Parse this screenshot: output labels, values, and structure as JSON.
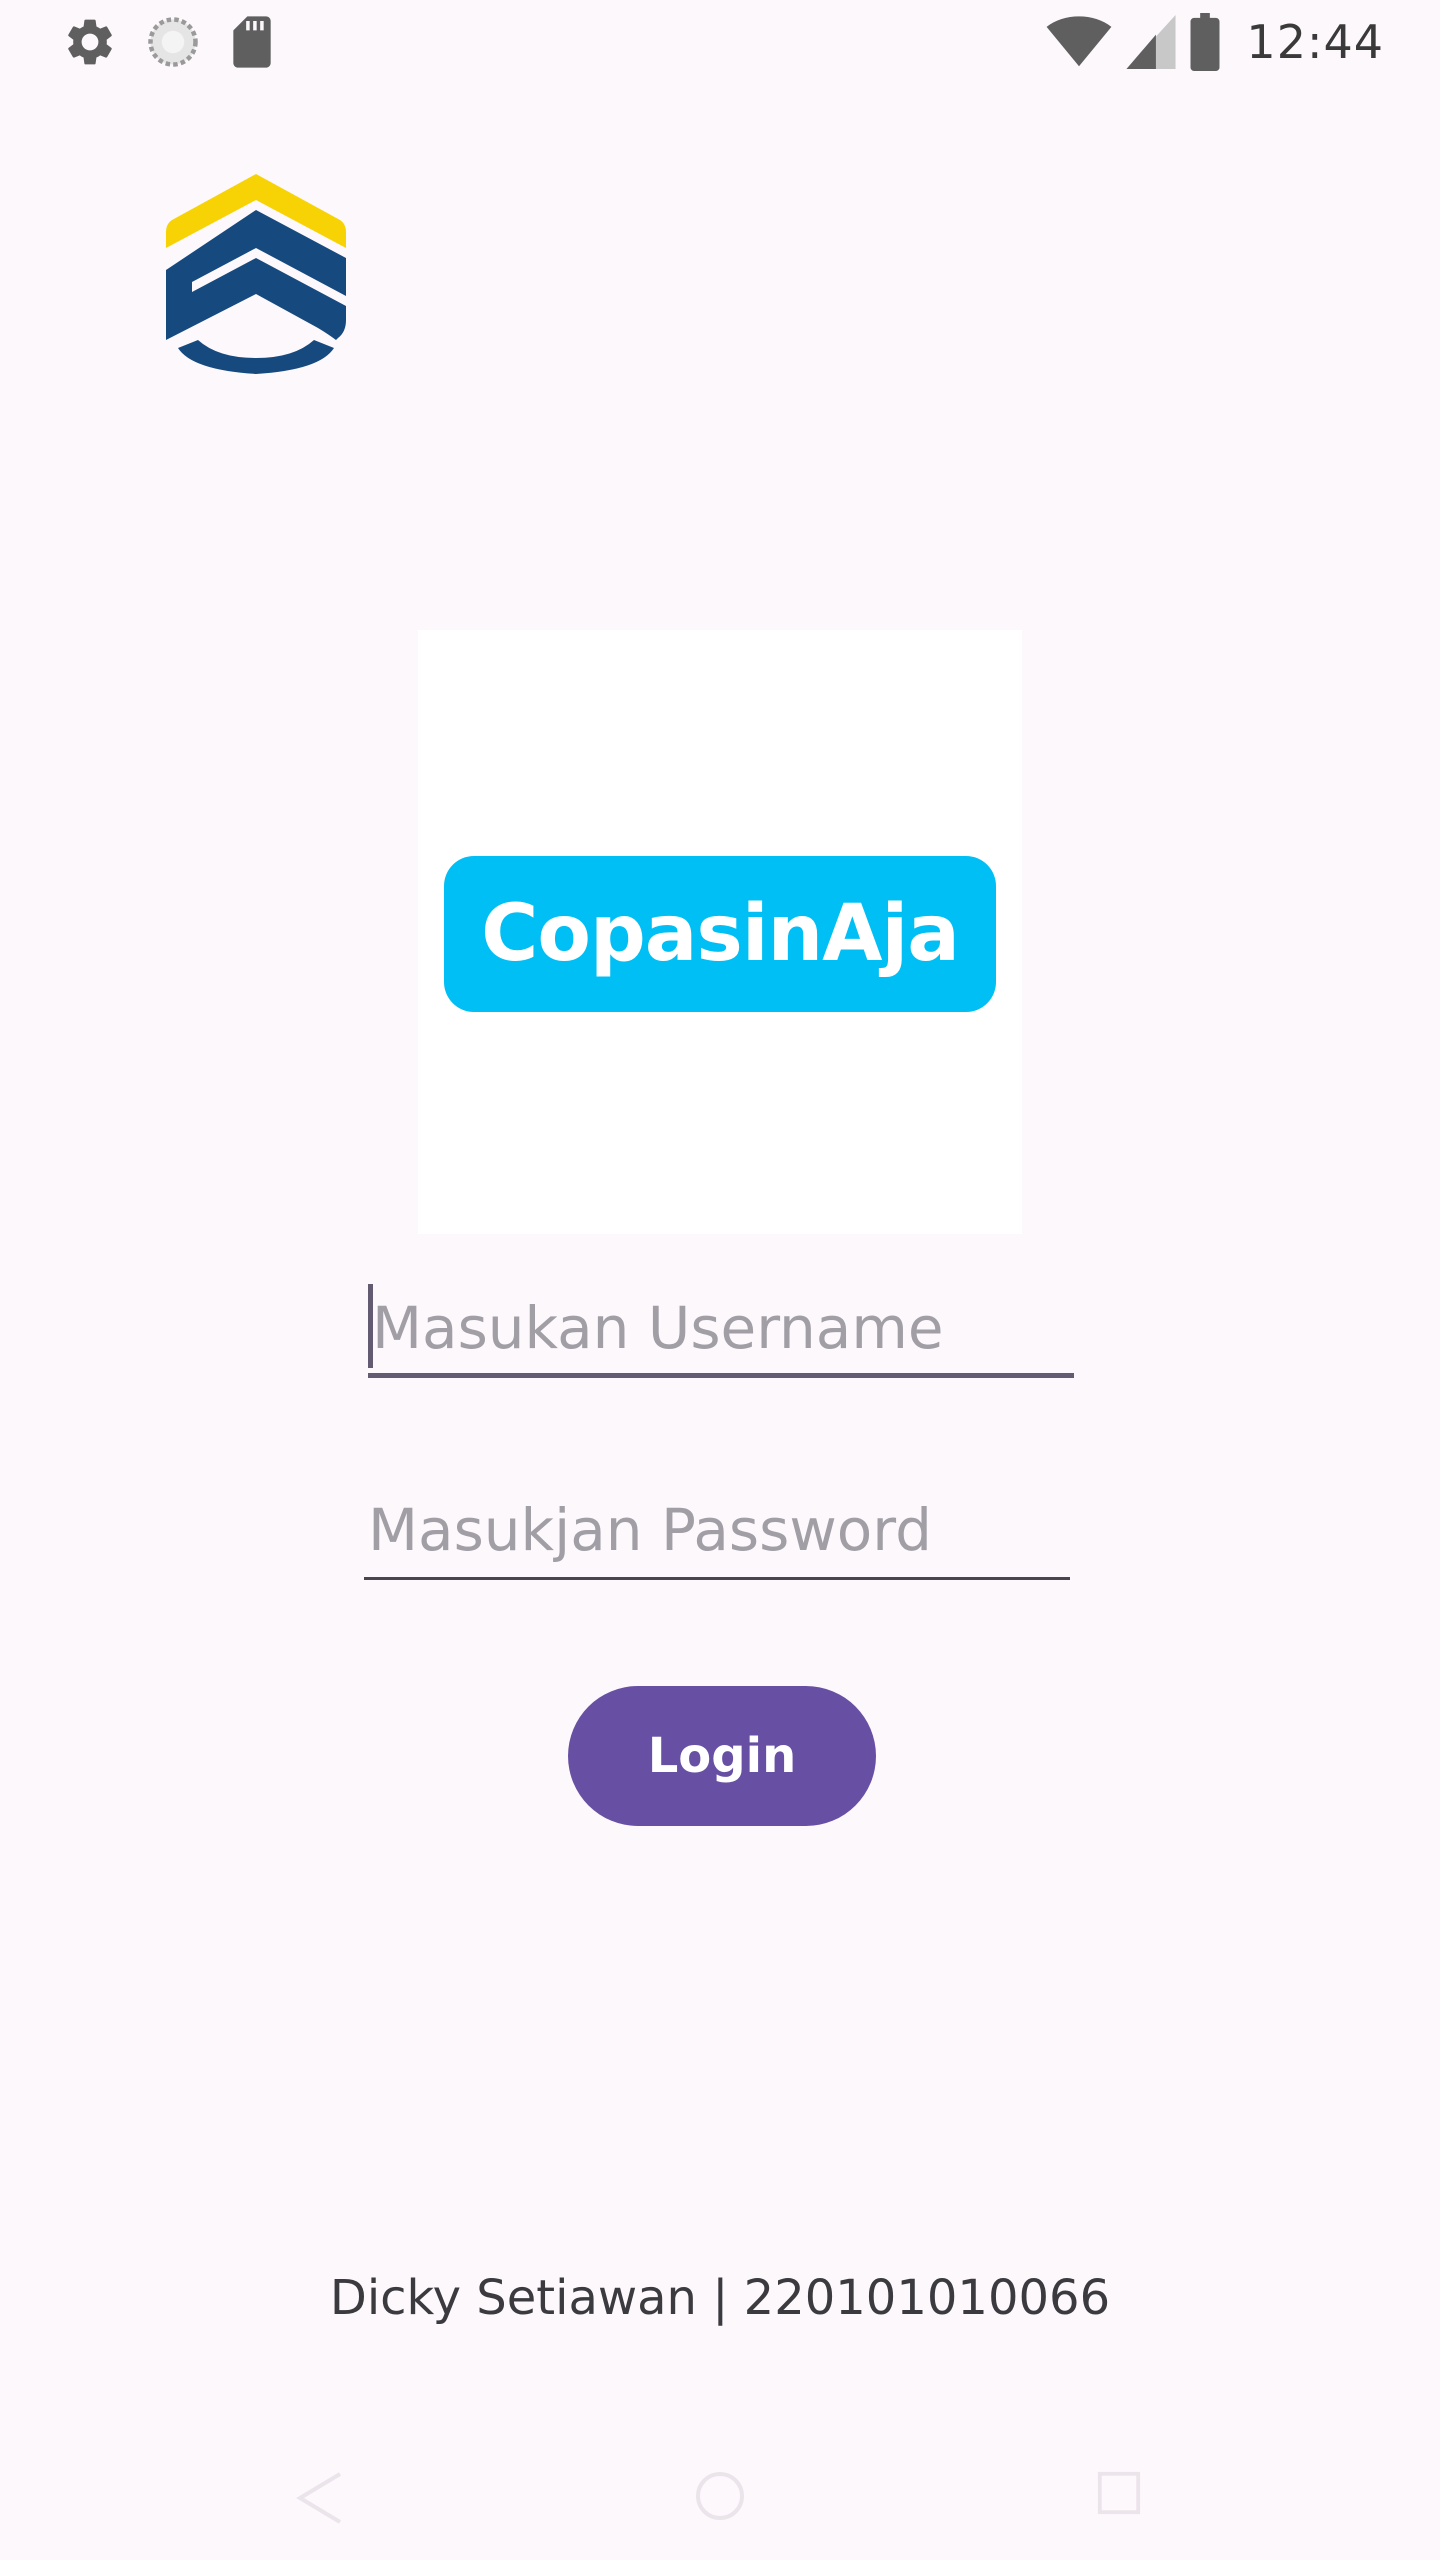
{
  "status_bar": {
    "time": "12:44",
    "left_icons": [
      "settings-icon",
      "sync-icon",
      "sd-card-icon"
    ],
    "right_icons": [
      "wifi-icon",
      "cell-signal-icon",
      "battery-icon"
    ]
  },
  "app_logo": {
    "icon": "shield-logo-icon",
    "colors": {
      "top": "#f7d306",
      "body": "#164a7f"
    }
  },
  "hero": {
    "brand_text": "CopasinAja",
    "pill_color": "#00bff5"
  },
  "form": {
    "username_placeholder": "Masukan Username",
    "password_placeholder": "Masukjan Password",
    "login_label": "Login"
  },
  "footer": {
    "credit": "Dicky Setiawan | 220101010066"
  },
  "colors": {
    "background": "#fdf8fc",
    "primary": "#6750a4",
    "outline": "#625b71"
  },
  "navbar": {
    "icons": [
      "back-icon",
      "home-icon",
      "recents-icon"
    ]
  }
}
